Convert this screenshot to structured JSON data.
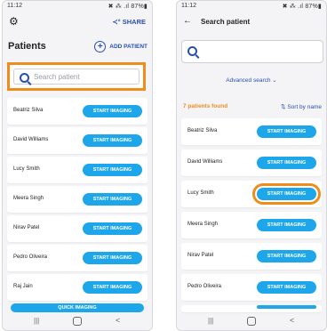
{
  "left": {
    "status": {
      "time": "11:12",
      "icons": "✖ ⁂ .ıl 87%▮"
    },
    "header": {
      "share_label": "SHARE"
    },
    "title": "Patients",
    "add_patient_label": "ADD PATIENT",
    "search": {
      "placeholder": "Search patient"
    },
    "patients": [
      {
        "name": "Beatriz Silva",
        "button": "START IMAGING"
      },
      {
        "name": "David Williams",
        "button": "START IMAGING"
      },
      {
        "name": "Lucy Smith",
        "button": "START IMAGING"
      },
      {
        "name": "Meera Singh",
        "button": "START IMAGING"
      },
      {
        "name": "Nirav Patel",
        "button": "START IMAGING"
      },
      {
        "name": "Pedro Oliveira",
        "button": "START IMAGING"
      },
      {
        "name": "Raj Jain",
        "button": "START IMAGING"
      }
    ],
    "quick_imaging_label": "QUICK IMAGING",
    "nav": {
      "recents": "|||",
      "back": "<"
    }
  },
  "right": {
    "status": {
      "time": "11:12",
      "icons": "✖ ⁂ .ıl 87%▮"
    },
    "title": "Search patient",
    "advanced_label": "Advanced search ⌄",
    "found_label": "7 patients found",
    "sort_label": "⇅ Sort by name",
    "patients": [
      {
        "name": "Beatriz Silva",
        "button": "START IMAGING"
      },
      {
        "name": "David Williams",
        "button": "START IMAGING"
      },
      {
        "name": "Lucy Smith",
        "button": "START IMAGING"
      },
      {
        "name": "Meera Singh",
        "button": "START IMAGING"
      },
      {
        "name": "Nirav Patel",
        "button": "START IMAGING"
      },
      {
        "name": "Pedro Oliveira",
        "button": "START IMAGING"
      }
    ],
    "nav": {
      "recents": "|||",
      "back": "<"
    }
  },
  "colors": {
    "accent": "#1ea6ea",
    "link": "#2a4fb3",
    "highlight": "#f08d1a"
  }
}
